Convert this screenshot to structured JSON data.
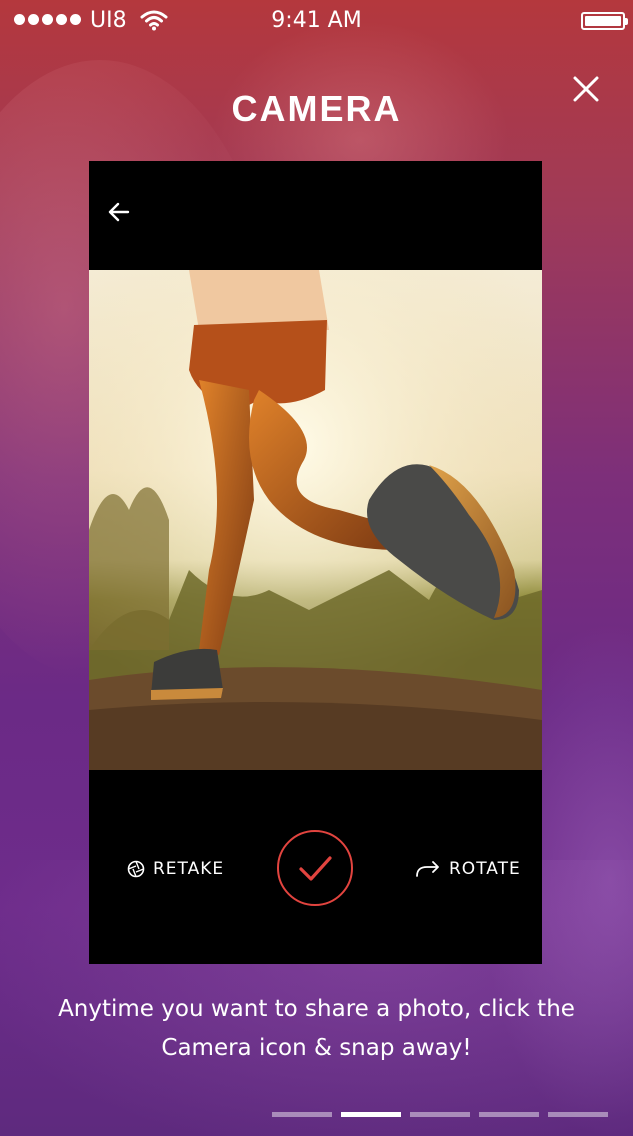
{
  "status_bar": {
    "carrier": "UI8",
    "time": "9:41 AM"
  },
  "header": {
    "title": "CAMERA"
  },
  "camera": {
    "photo_subject": "runner-legs-on-dirt-trail",
    "actions": {
      "retake_label": "RETAKE",
      "rotate_label": "ROTATE"
    }
  },
  "caption": "Anytime you want to share a photo, click the Camera icon & snap away!",
  "pager": {
    "total": 5,
    "active_index": 1
  },
  "colors": {
    "accent": "#e2443f",
    "bg_top": "#b4383d",
    "bg_bottom": "#5e2a7e"
  }
}
